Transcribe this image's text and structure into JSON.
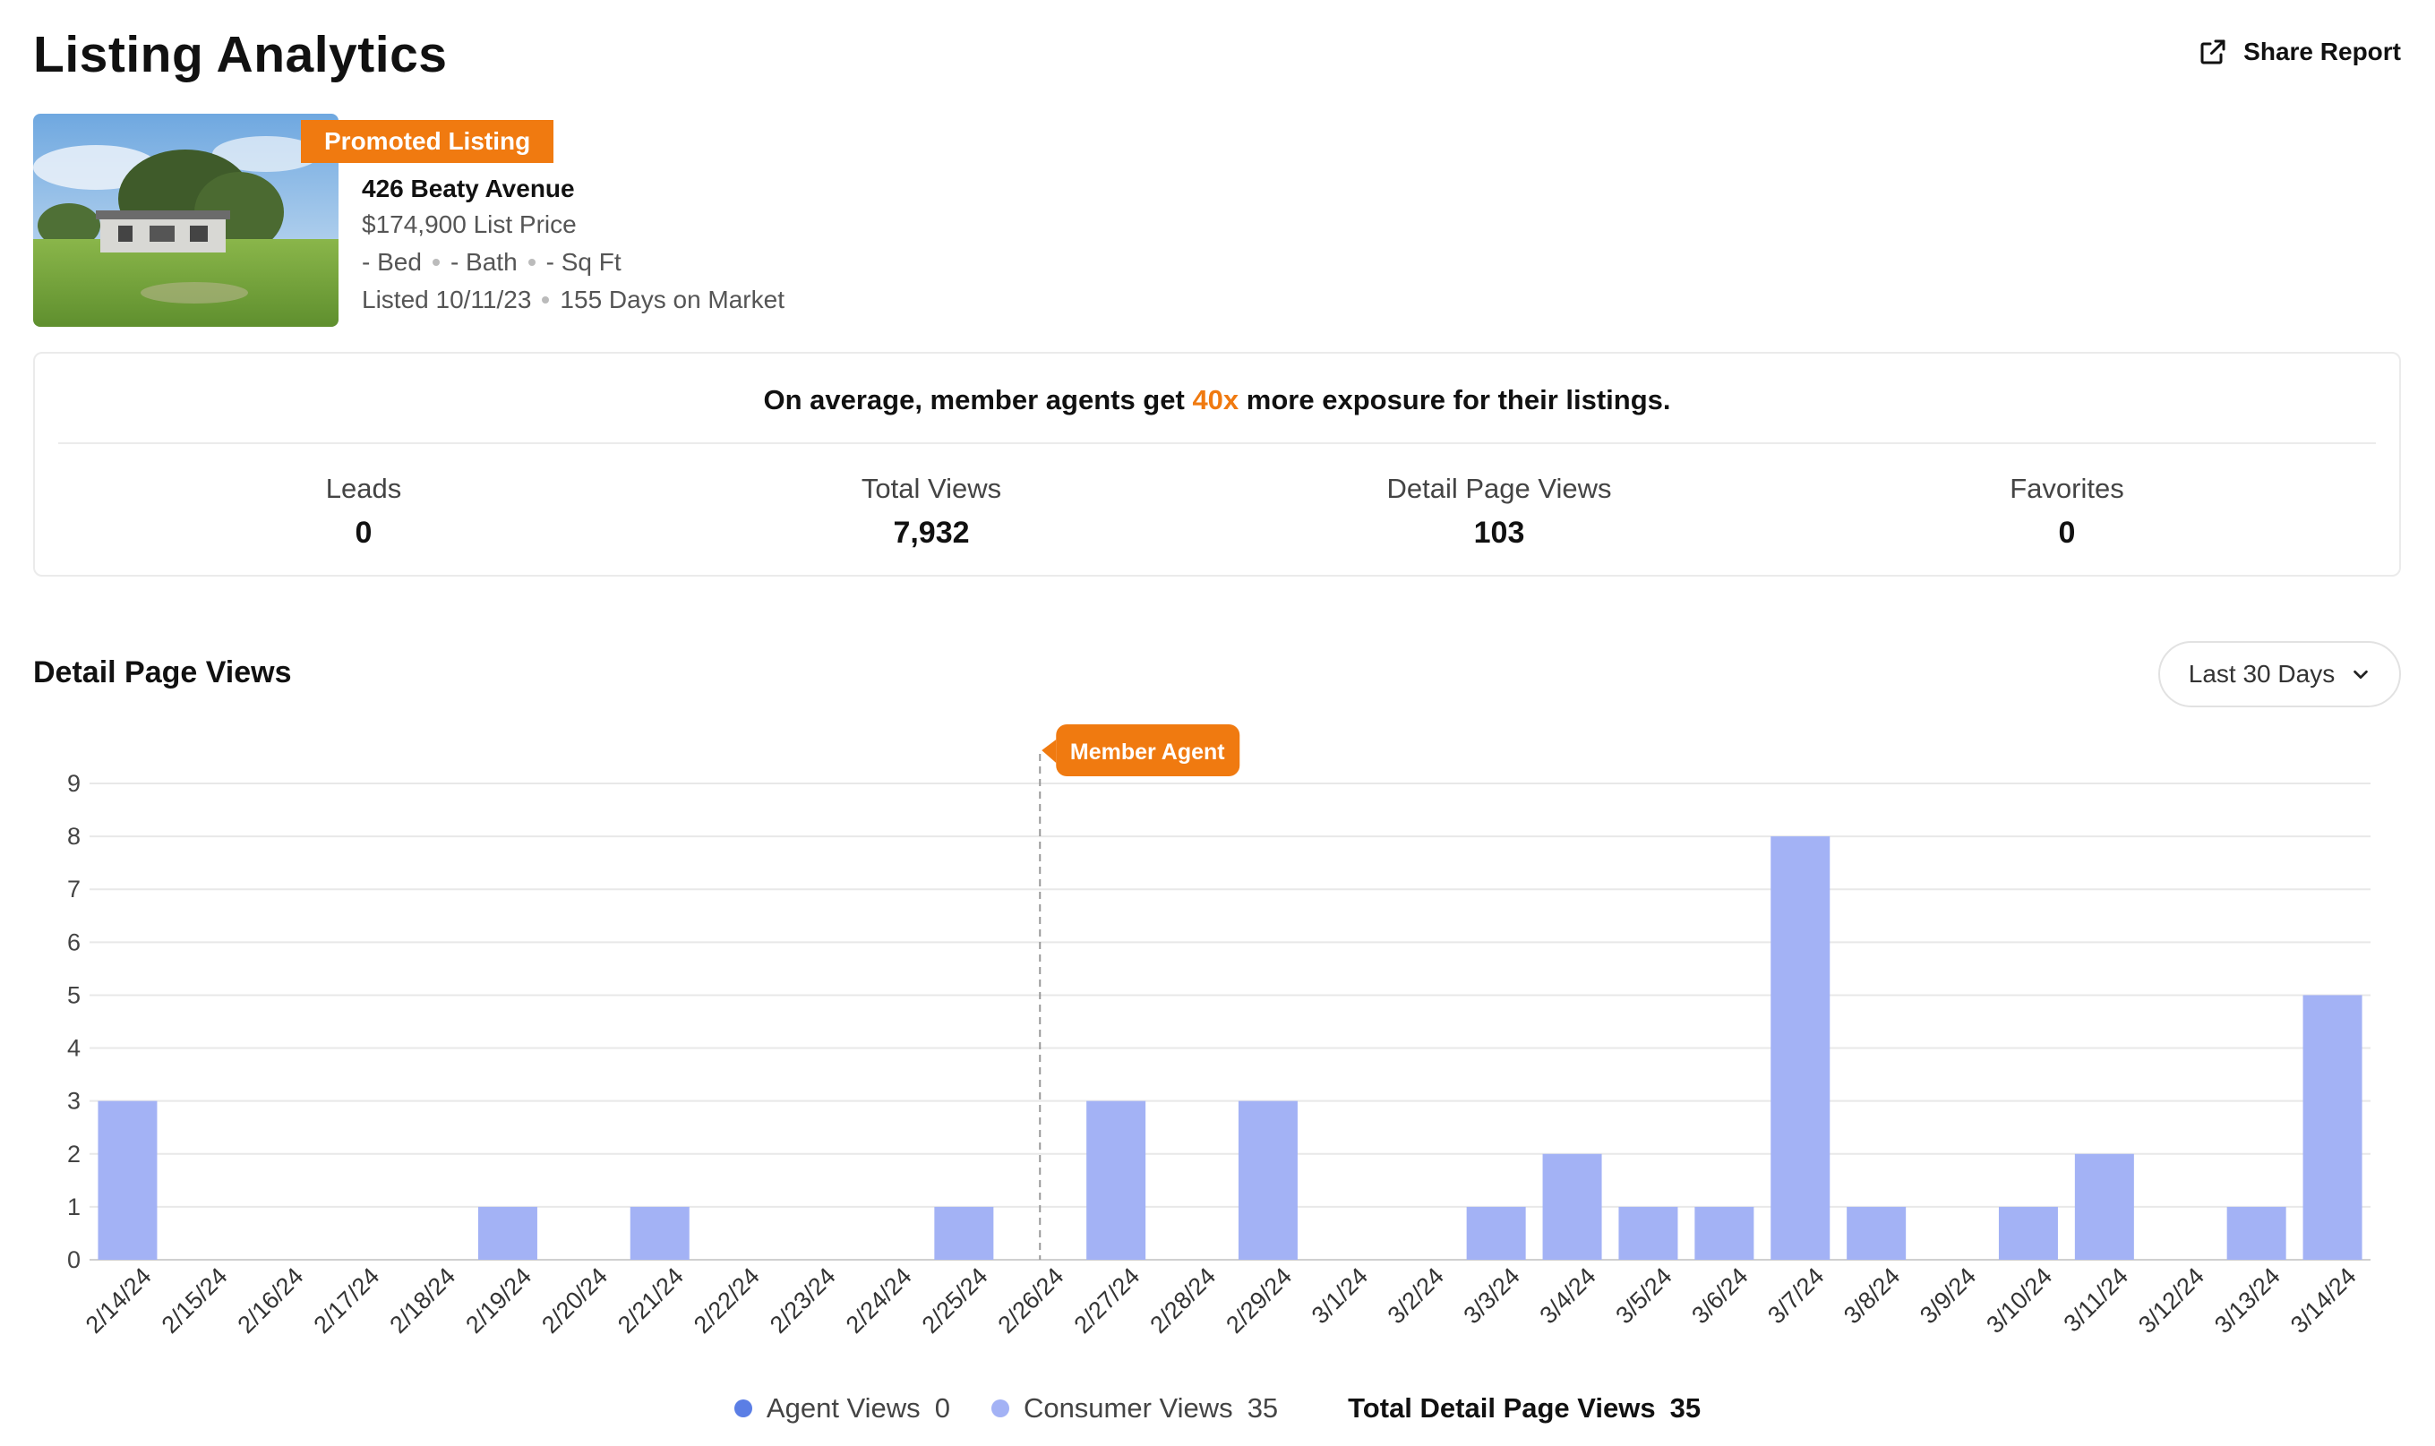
{
  "header": {
    "title": "Listing Analytics",
    "share_label": "Share Report"
  },
  "listing": {
    "badge": "Promoted Listing",
    "address": "426 Beaty Avenue",
    "price": "$174,900 List Price",
    "bed": "- Bed",
    "bath": "- Bath",
    "sqft": "- Sq Ft",
    "listed": "Listed 10/11/23",
    "days_on_market": "155 Days on Market"
  },
  "promo": {
    "text_before": "On average, member agents get",
    "highlight": "40x",
    "text_after": "more exposure for their listings."
  },
  "stats": [
    {
      "label": "Leads",
      "value": "0"
    },
    {
      "label": "Total Views",
      "value": "7,932"
    },
    {
      "label": "Detail Page Views",
      "value": "103"
    },
    {
      "label": "Favorites",
      "value": "0"
    }
  ],
  "section": {
    "title": "Detail Page Views",
    "range": "Last 30 Days"
  },
  "colors": {
    "accent": "#f07a10",
    "agent_views": "#5b7ee5",
    "consumer_views": "#a3b2f5"
  },
  "chart_data": {
    "type": "bar",
    "categories": [
      "2/14/24",
      "2/15/24",
      "2/16/24",
      "2/17/24",
      "2/18/24",
      "2/19/24",
      "2/20/24",
      "2/21/24",
      "2/22/24",
      "2/23/24",
      "2/24/24",
      "2/25/24",
      "2/26/24",
      "2/27/24",
      "2/28/24",
      "2/29/24",
      "3/1/24",
      "3/2/24",
      "3/3/24",
      "3/4/24",
      "3/5/24",
      "3/6/24",
      "3/7/24",
      "3/8/24",
      "3/9/24",
      "3/10/24",
      "3/11/24",
      "3/12/24",
      "3/13/24",
      "3/14/24"
    ],
    "series": [
      {
        "name": "Consumer Views",
        "values": [
          3,
          0,
          0,
          0,
          0,
          1,
          0,
          1,
          0,
          0,
          0,
          1,
          0,
          3,
          0,
          3,
          0,
          0,
          1,
          2,
          1,
          1,
          8,
          1,
          0,
          1,
          2,
          0,
          1,
          5
        ]
      },
      {
        "name": "Agent Views",
        "values": [
          0,
          0,
          0,
          0,
          0,
          0,
          0,
          0,
          0,
          0,
          0,
          0,
          0,
          0,
          0,
          0,
          0,
          0,
          0,
          0,
          0,
          0,
          0,
          0,
          0,
          0,
          0,
          0,
          0,
          0
        ]
      }
    ],
    "yticks": [
      0,
      1,
      2,
      3,
      4,
      5,
      6,
      7,
      8,
      9
    ],
    "ylim": [
      0,
      9
    ],
    "grid": true,
    "marker": {
      "category": "2/26/24",
      "label": "Member Agent"
    }
  },
  "legend": {
    "agent_label": "Agent Views",
    "agent_value": "0",
    "consumer_label": "Consumer Views",
    "consumer_value": "35",
    "total_label": "Total Detail Page Views",
    "total_value": "35"
  }
}
